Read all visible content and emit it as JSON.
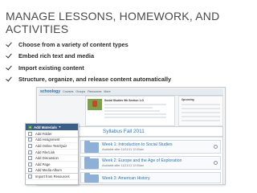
{
  "slide": {
    "title": "MANAGE LESSONS, HOMEWORK, AND ACTIVITIES",
    "bullets": [
      "Choose from a variety of content types",
      "Embed rich text and media",
      "Import existing content",
      "Structure, organize, and release content automatically"
    ]
  },
  "app": {
    "logo": "schoology",
    "nav": [
      "Courses",
      "Groups",
      "Resources",
      "More"
    ],
    "course_title": "Social Studies 9th Section 1-G",
    "right_panel_title": "Upcoming"
  },
  "menu": {
    "header": "Add Materials",
    "items": [
      "Add Folder",
      "Add Assignment",
      "Add Online Test/Quiz",
      "Add File/Link",
      "Add Discussion",
      "Add Page",
      "Add Media Album",
      "Import from Resources"
    ]
  },
  "syllabus": {
    "title": "Syllabus Fall 2011",
    "weeks": [
      {
        "title": "Week 1: Introduction to Social Studies",
        "sub": "Available after 11/01/11 12:00am"
      },
      {
        "title": "Week 2: Europe and the Age of Exploration",
        "sub": "Available after 11/21/11 12:00am"
      },
      {
        "title": "Week 3: American History",
        "sub": ""
      }
    ]
  }
}
